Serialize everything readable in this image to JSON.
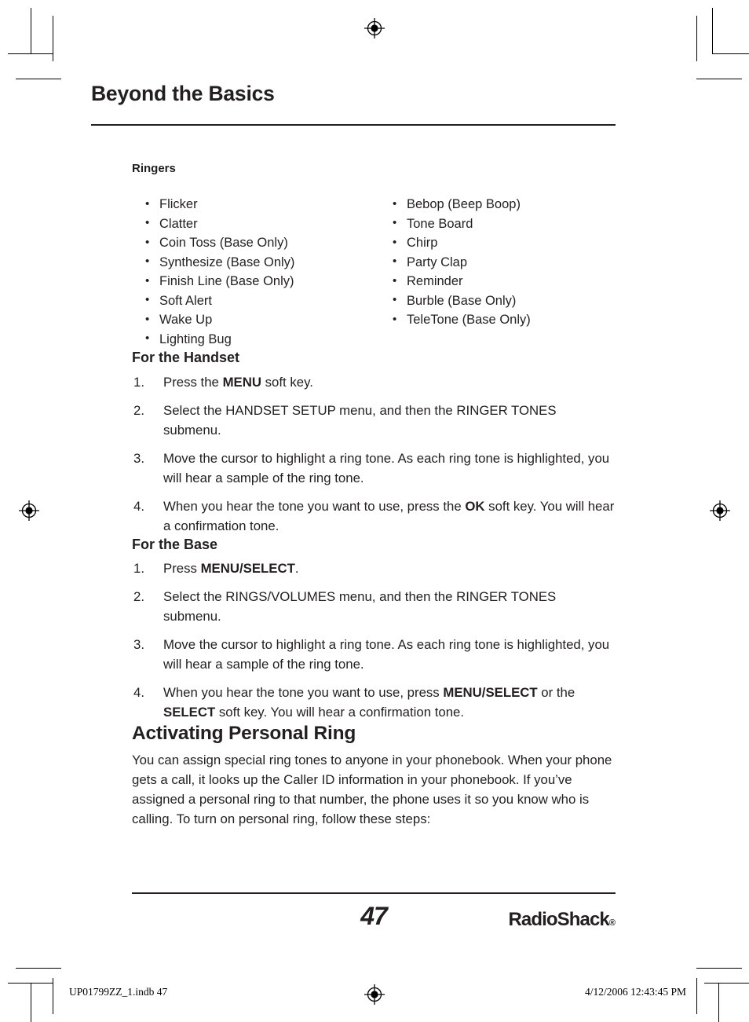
{
  "document": {
    "chapter_title": "Beyond the Basics",
    "page_number": "47",
    "brand": "RadioShack",
    "brand_mark": "®"
  },
  "ringers": {
    "subhead": "Ringers",
    "column_left": [
      "Flicker",
      "Clatter",
      "Coin Toss (Base Only)",
      "Synthesize (Base Only)",
      "Finish Line (Base Only)",
      "Soft Alert",
      "Wake Up",
      "Lighting Bug"
    ],
    "column_right": [
      "Bebop (Beep Boop)",
      "Tone Board",
      "Chirp",
      "Party Clap",
      "Reminder",
      "Burble (Base Only)",
      "TeleTone (Base Only)"
    ]
  },
  "for_the_handset": {
    "heading": "For the Handset",
    "steps": [
      {
        "num": "1.",
        "parts": [
          {
            "t": "Press the ",
            "b": false
          },
          {
            "t": "MENU",
            "b": true
          },
          {
            "t": " soft key.",
            "b": false
          }
        ]
      },
      {
        "num": "2.",
        "parts": [
          {
            "t": "Select the HANDSET SETUP menu, and then the RINGER TONES submenu.",
            "b": false
          }
        ]
      },
      {
        "num": "3.",
        "parts": [
          {
            "t": "Move the cursor to highlight a ring tone. As each ring tone is highlighted, you will hear a sample of the ring tone.",
            "b": false
          }
        ]
      },
      {
        "num": "4.",
        "parts": [
          {
            "t": "When you hear the tone you want to use, press the ",
            "b": false
          },
          {
            "t": "OK",
            "b": true
          },
          {
            "t": " soft key. You will hear a confirmation tone.",
            "b": false
          }
        ]
      }
    ]
  },
  "for_the_base": {
    "heading": "For the Base",
    "steps": [
      {
        "num": "1.",
        "parts": [
          {
            "t": "Press ",
            "b": false
          },
          {
            "t": "MENU/SELECT",
            "b": true
          },
          {
            "t": ".",
            "b": false
          }
        ]
      },
      {
        "num": "2.",
        "parts": [
          {
            "t": "Select the RINGS/VOLUMES menu, and then the RINGER TONES submenu.",
            "b": false
          }
        ]
      },
      {
        "num": "3.",
        "parts": [
          {
            "t": "Move the cursor to highlight a ring tone. As each ring tone is highlighted, you will hear a sample of the ring tone.",
            "b": false
          }
        ]
      },
      {
        "num": "4.",
        "parts": [
          {
            "t": "When you hear the tone you want to use, press ",
            "b": false
          },
          {
            "t": "MENU/",
            "b": true
          },
          {
            "t": "SELECT",
            "b": true
          },
          {
            "t": " or the ",
            "b": false
          },
          {
            "t": "SELECT",
            "b": true
          },
          {
            "t": " soft key. You will hear a confirmation tone.",
            "b": false
          }
        ]
      }
    ]
  },
  "activating_personal_ring": {
    "heading": "Activating Personal Ring",
    "body": "You can assign special ring tones to anyone in your phonebook. When your phone gets a call, it looks up the Caller ID information in your phonebook. If you’ve assigned a personal ring to that number, the phone uses it so you know who is calling. To turn on personal ring, follow these steps:"
  },
  "print_slug": {
    "file": "UP01799ZZ_1.indb   47",
    "timestamp": "4/12/2006   12:43:45 PM"
  }
}
